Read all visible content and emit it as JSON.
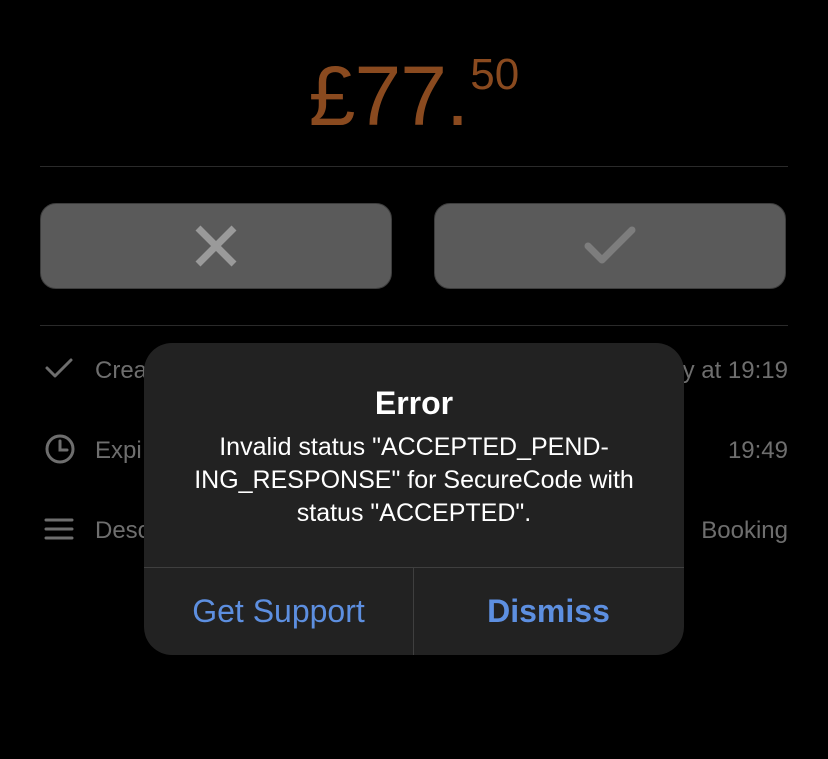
{
  "amount": {
    "main": "£77.",
    "cents": "50"
  },
  "actions": {
    "reject_icon": "x-icon",
    "accept_icon": "checkmark-icon"
  },
  "details": [
    {
      "icon": "checkmark-icon",
      "label": "Crea",
      "value": "y at 19:19"
    },
    {
      "icon": "clock-icon",
      "label": "Expi",
      "value": "19:49"
    },
    {
      "icon": "menu-lines-icon",
      "label": "Desc",
      "value": "Booking"
    }
  ],
  "dialog": {
    "title": "Error",
    "message": "Invalid status \"ACCEPTED_PEND-\nING_RESPONSE\" for SecureCode with\nstatus \"ACCEPTED\".",
    "secondary_button": "Get Support",
    "primary_button": "Dismiss"
  },
  "colors": {
    "amount": "#8a4a1f",
    "button_bg": "#5a5a5a",
    "dialog_bg": "#222222",
    "link_blue": "#5d8fe0"
  }
}
